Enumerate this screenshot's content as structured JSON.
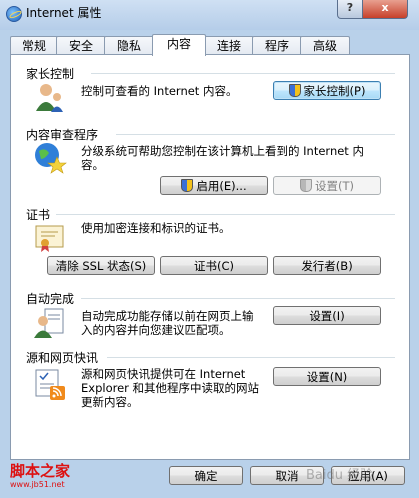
{
  "window": {
    "title": "Internet 属性",
    "help_label": "?",
    "close_label": "x"
  },
  "tabs": [
    {
      "label": "常规"
    },
    {
      "label": "安全"
    },
    {
      "label": "隐私"
    },
    {
      "label": "内容",
      "active": true
    },
    {
      "label": "连接"
    },
    {
      "label": "程序"
    },
    {
      "label": "高级"
    }
  ],
  "groups": {
    "parental": {
      "title": "家长控制",
      "description": "控制可查看的 Internet 内容。",
      "button": "家长控制(P)"
    },
    "advisor": {
      "title": "内容审查程序",
      "description": "分级系统可帮助您控制在该计算机上看到的 Internet 内\n容。",
      "enable_button": "启用(E)...",
      "settings_button": "设置(T)"
    },
    "certificates": {
      "title": "证书",
      "description": "使用加密连接和标识的证书。",
      "clear_ssl_button": "清除 SSL 状态(S)",
      "certificates_button": "证书(C)",
      "publishers_button": "发行者(B)"
    },
    "autocomplete": {
      "title": "自动完成",
      "description": "自动完成功能存储以前在网页上输\n入的内容并向您建议匹配项。",
      "settings_button": "设置(I)"
    },
    "feeds": {
      "title": "源和网页快讯",
      "description": "源和网页快讯提供可在 Internet\nExplorer 和其他程序中读取的网站\n更新内容。",
      "settings_button": "设置(N)"
    }
  },
  "footer": {
    "ok_button": "确定",
    "cancel_button": "取消",
    "apply_button": "应用(A)"
  },
  "watermarks": {
    "left_main": "脚本之家",
    "left_sub": "www.jb51.net",
    "right": "Baidu 经验"
  },
  "colors": {
    "window_frame": "#b9d1ea",
    "panel": "#ffffff",
    "close_button": "#c7402a",
    "watermark_red": "#dd1111"
  }
}
